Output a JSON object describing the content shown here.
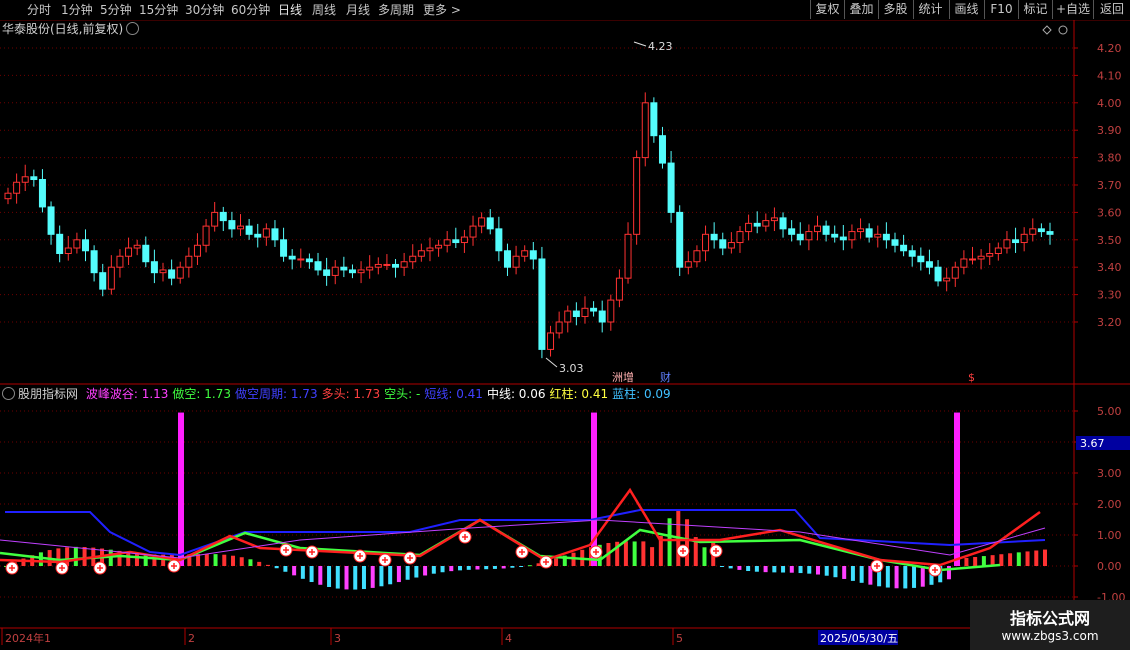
{
  "toolbar": {
    "periods": [
      "分时",
      "1分钟",
      "5分钟",
      "15分钟",
      "30分钟",
      "60分钟",
      "日线",
      "周线",
      "月线",
      "多周期",
      "更多"
    ],
    "active_period": "日线",
    "right_buttons": [
      "复权",
      "叠加",
      "多股",
      "统计",
      "画线",
      "F10",
      "标记",
      "+自选",
      "返回"
    ]
  },
  "price_panel": {
    "title": "华泰股份(日线,前复权)",
    "y_ticks": [
      "4.20",
      "4.10",
      "4.00",
      "3.90",
      "3.80",
      "3.70",
      "3.60",
      "3.50",
      "3.40",
      "3.30",
      "3.20"
    ],
    "high_label": "4.23",
    "low_label": "3.03",
    "event_tags": [
      "洲增",
      "财",
      "$"
    ]
  },
  "indicator_panel": {
    "name": "股朋指标网",
    "values": [
      {
        "label": "波峰波谷: 1.13",
        "color": "#ff40ff"
      },
      {
        "label": "做空: 1.73",
        "color": "#40ff40"
      },
      {
        "label": "做空周期: 1.73",
        "color": "#4040ff"
      },
      {
        "label": "多头: 1.73",
        "color": "#ff4040"
      },
      {
        "label": "空头: -",
        "color": "#40ff40"
      },
      {
        "label": "短线: 0.41",
        "color": "#4040ff"
      },
      {
        "label": "中线: 0.06",
        "color": "#ffffff"
      },
      {
        "label": "红柱: 0.41",
        "color": "#ffff40"
      },
      {
        "label": "蓝柱: 0.09",
        "color": "#40c0ff"
      }
    ],
    "y_ticks": [
      "5.00",
      "4.00",
      "3.00",
      "2.00",
      "1.00",
      "0.00",
      "-1.00"
    ],
    "current_value": "3.67"
  },
  "date_axis": {
    "labels": [
      "2024年1",
      "2",
      "3",
      "4",
      "5"
    ],
    "cursor_date": "2025/05/30/五"
  },
  "watermark": {
    "line1": "指标公式网",
    "line2": "www.zbgs3.com"
  },
  "colors": {
    "up": "#ff3232",
    "down": "#54fcfc",
    "grid": "#6e0000",
    "axis": "#b00000"
  }
}
